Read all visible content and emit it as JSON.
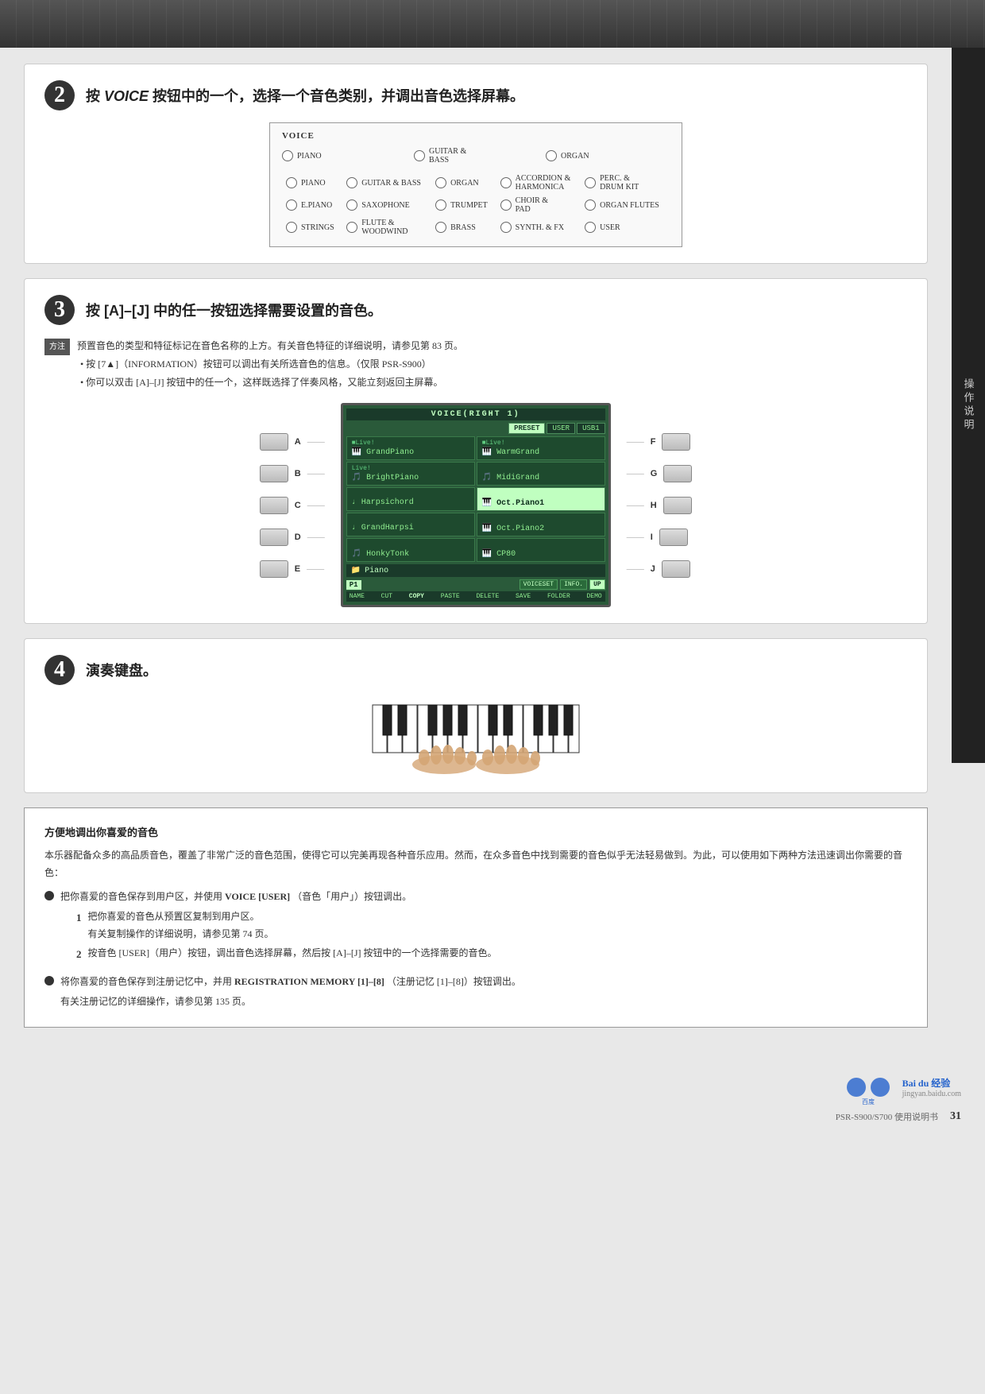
{
  "header": {
    "banner_note": "decorative music banner"
  },
  "sidebar": {
    "text": "操作说明"
  },
  "section2": {
    "number": "2",
    "title_prefix": "按 ",
    "title_key": "VOICE",
    "title_suffix": " 按钮中的一个，选择一个音色类别，并调出音色选择屏幕。",
    "voice_label": "VOICE",
    "voice_buttons": [
      {
        "id": "piano",
        "label": "PIANO"
      },
      {
        "id": "guitar-bass",
        "label": "GUITAR & BASS"
      },
      {
        "id": "organ",
        "label": "ORGAN"
      },
      {
        "id": "accordion-harmonica",
        "label": "ACCORDION & HARMONICA"
      },
      {
        "id": "perc-drum",
        "label": "PERC. & DRUM KIT"
      },
      {
        "id": "epiano",
        "label": "E.PIANO"
      },
      {
        "id": "saxophone",
        "label": "SAXOPHONE"
      },
      {
        "id": "trumpet",
        "label": "TRUMPET"
      },
      {
        "id": "choir-pad",
        "label": "CHOIR & PAD"
      },
      {
        "id": "organ-flutes",
        "label": "ORGAN FLUTES"
      },
      {
        "id": "strings",
        "label": "STRINGS"
      },
      {
        "id": "flute-woodwind",
        "label": "FLUTE & WOODWIND"
      },
      {
        "id": "brass",
        "label": "BRASS"
      },
      {
        "id": "synth-fx",
        "label": "SYNTH. & FX"
      },
      {
        "id": "user",
        "label": "USER"
      }
    ]
  },
  "section3": {
    "number": "3",
    "title": "按 [A]–[J] 中的任一按钮选择需要设置的音色。",
    "note_label": "方注",
    "notes": [
      "预置音色的类型和特征标记在音色名称的上方。有关音色特征的详细说明，请参见第 83 页。",
      "按 [7▲]（INFORMATION）按钮可以调出有关所选音色的信息。（仅限 PSR-S900）",
      "你可以双击 [A]–[J] 按钮中的任一个，这样既选择了伴奏风格，又能立刻返回主屏幕。"
    ],
    "screen_title": "VOICE(RIGHT 1)",
    "tabs": [
      "PRESET",
      "USER",
      "USB1"
    ],
    "active_tab": "PRESET",
    "voice_items": [
      {
        "label": "GrandPiano",
        "badge": "Live!",
        "icon": "piano",
        "col": 0,
        "row": 0,
        "selected": false
      },
      {
        "label": "WarmGrand",
        "badge": "Live!",
        "icon": "piano",
        "col": 1,
        "row": 0,
        "selected": false
      },
      {
        "label": "BrightPiano",
        "badge": "Live!",
        "icon": "piano",
        "col": 0,
        "row": 1,
        "selected": false
      },
      {
        "label": "MidiGrand",
        "badge": "",
        "icon": "piano",
        "col": 1,
        "row": 1,
        "selected": false
      },
      {
        "label": "Harpsichord",
        "badge": "",
        "icon": "harp",
        "col": 0,
        "row": 2,
        "selected": false
      },
      {
        "label": "Oct.Piano1",
        "badge": "",
        "icon": "piano",
        "col": 1,
        "row": 2,
        "selected": true
      },
      {
        "label": "GrandHarpsi",
        "badge": "",
        "icon": "harp",
        "col": 0,
        "row": 3,
        "selected": false
      },
      {
        "label": "Oct.Piano2",
        "badge": "",
        "icon": "piano",
        "col": 1,
        "row": 3,
        "selected": false
      },
      {
        "label": "HonkyTonk",
        "badge": "",
        "icon": "piano",
        "col": 0,
        "row": 4,
        "selected": false
      },
      {
        "label": "CP80",
        "badge": "",
        "icon": "piano",
        "col": 1,
        "row": 4,
        "selected": false
      }
    ],
    "folder": "Piano",
    "page_label": "P1",
    "action_buttons": [
      "VOICESET",
      "INFO.",
      "UP"
    ],
    "menu_items": [
      "NAME",
      "CUT",
      "COPY",
      "PASTE",
      "DELETE",
      "SAVE",
      "FOLDER",
      "DEMO"
    ],
    "button_labels_left": [
      "A",
      "B",
      "C",
      "D",
      "E"
    ],
    "button_labels_right": [
      "F",
      "G",
      "H",
      "I",
      "J"
    ]
  },
  "section4": {
    "number": "4",
    "title": "演奏键盘。"
  },
  "info_box": {
    "title": "方便地调出你喜爱的音色",
    "intro": "本乐器配备众多的高品质音色，覆盖了非常广泛的音色范围，使得它可以完美再现各种音乐应用。然而，在众多音色中找到需要的音色似乎无法轻易做到。为此，可以使用如下两种方法迅速调出你需要的音色：",
    "bullet1": {
      "text": "把你喜爱的音色保存到用户区，并使用 VOICE [USER]（音色「用户」）按钮调出。",
      "key": "VOICE [USER]",
      "sub1_num": "1",
      "sub1_text": "把你喜爱的音色从预置区复制到用户区。",
      "sub1_note": "有关复制操作的详细说明，请参见第 74 页。",
      "sub2_num": "2",
      "sub2_text": "按音色 [USER]（用户）按钮，调出音色选择屏幕，然后按 [A]–[J] 按钮中的一个选择需要的音色。"
    },
    "bullet2": {
      "text_prefix": "将你喜爱的音色保存到注册记忆中，并用 ",
      "text_key": "REGISTRATION MEMORY [1]–[8]",
      "text_suffix": "（注册记忆 [1]–[8]）按钮调出。",
      "note": "有关注册记忆的详细操作，请参见第 135 页。"
    }
  },
  "footer": {
    "model": "PSR-S900/S700 使用说明书",
    "page": "31",
    "baidu_url": "jingyan.baidu.com"
  }
}
